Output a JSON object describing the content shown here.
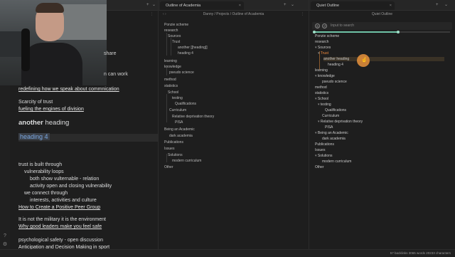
{
  "note_pane": {
    "ghost_lines": [
      "share",
      "n can work"
    ],
    "lines": [
      {
        "text": "redefining how we speak about commnication",
        "link": true
      },
      {
        "text": "Scarcity of trust",
        "link": false
      },
      {
        "text": "fueling the engines of division",
        "link": true
      },
      {
        "text": "trust is built through",
        "link": false
      },
      {
        "text": "vulnerability loops",
        "link": false
      },
      {
        "text": "both show vulternable - relation",
        "link": false
      },
      {
        "text": "activity open and closing vulnerability",
        "link": false
      },
      {
        "text": "we connect through",
        "link": false
      },
      {
        "text": "interests, activities and culture",
        "link": false
      },
      {
        "text": "How to Create a Positive Peer Group",
        "link": true
      },
      {
        "text": "It is not the military it is the environment",
        "link": false
      },
      {
        "text": "Why good leaders make you feel safe",
        "link": true
      },
      {
        "text": "psychological safety - open discussion",
        "link": false
      },
      {
        "text": "Anticipation and Decision Making in sport",
        "link": true
      }
    ],
    "heading_bold": "another",
    "heading_rest": "heading",
    "heading4": "heading 4"
  },
  "outline_pane": {
    "tab_title": "Outline of Academia",
    "breadcrumb": "Danny / Projects / Outline of Academia",
    "items": [
      "Ponzie scheme",
      "research",
      "Sources",
      "Trust",
      "another [[heading]]",
      "heading 4",
      "learning",
      "knowledge",
      "pseudo science",
      "method",
      "statistics",
      "School",
      "testing",
      "Qualifications",
      "Curriculum",
      "Relative deprivation theory",
      "PISA",
      "Being an Academic",
      "dark academia",
      "Publications",
      "Issues",
      "Solutions",
      "modern curriculum",
      "Other"
    ]
  },
  "quiet_pane": {
    "tab_title": "Quiet Outline",
    "header": "Quiet Outline",
    "search_placeholder": "Input to search",
    "slider_level": 0.62,
    "items": [
      "Ponzie scheme",
      "research",
      "Sources",
      "Trust",
      "another heading",
      "heading 4",
      "learning",
      "knowledge",
      "pseudo science",
      "method",
      "statistics",
      "School",
      "testing",
      "Qualifications",
      "Curriculum",
      "Relative deprivation theory",
      "PISA",
      "Being an Academic",
      "dark academia",
      "Publications",
      "Issues",
      "Solutions",
      "modern curriculum",
      "Other"
    ],
    "accent": "#f08a3c"
  },
  "status": "57 backlinks   3065 words   20233 characters",
  "icons": [
    "plus-icon",
    "chevron-down-icon",
    "close-icon",
    "search-icon",
    "more-icon"
  ]
}
